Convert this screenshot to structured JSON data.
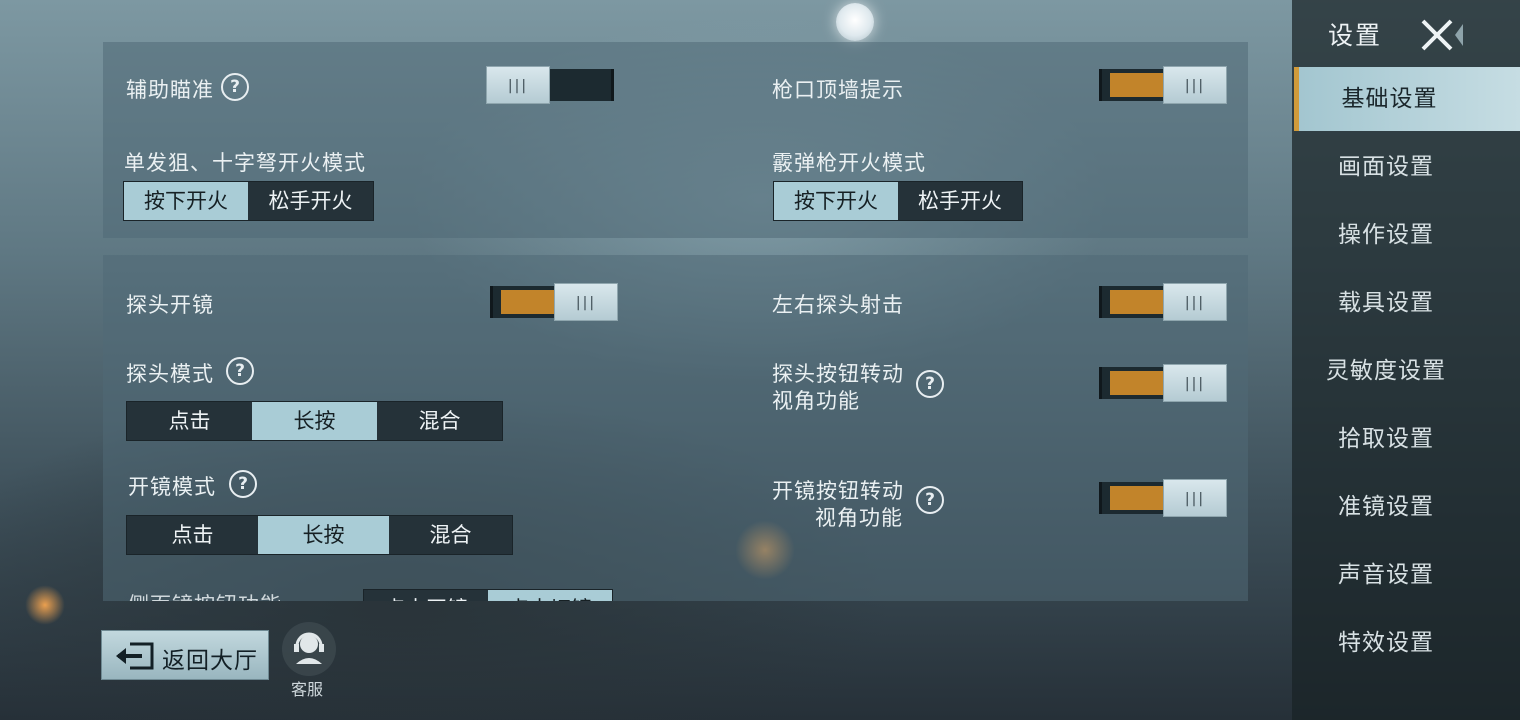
{
  "sidebar": {
    "title": "设置",
    "items": [
      "基础设置",
      "画面设置",
      "操作设置",
      "载具设置",
      "灵敏度设置",
      "拾取设置",
      "准镜设置",
      "声音设置",
      "特效设置"
    ],
    "active": "基础设置"
  },
  "panel1": {
    "assist_aim": {
      "label": "辅助瞄准",
      "on": false
    },
    "muzzle_wall": {
      "label": "枪口顶墙提示",
      "on": true
    },
    "sniper_fire": {
      "label": "单发狙、十字弩开火模式",
      "options": [
        "按下开火",
        "松手开火"
      ],
      "selected": "按下开火"
    },
    "shotgun_fire": {
      "label": "霰弹枪开火模式",
      "options": [
        "按下开火",
        "松手开火"
      ],
      "selected": "按下开火"
    }
  },
  "panel2": {
    "peek_scope": {
      "label": "探头开镜",
      "on": true
    },
    "lr_peek_shoot": {
      "label": "左右探头射击",
      "on": true
    },
    "peek_mode": {
      "label": "探头模式",
      "options": [
        "点击",
        "长按",
        "混合"
      ],
      "selected": "长按"
    },
    "peek_rotate": {
      "label_line1": "探头按钮转动",
      "label_line2": "视角功能",
      "on": true
    },
    "scope_mode": {
      "label": "开镜模式",
      "options": [
        "点击",
        "长按",
        "混合"
      ],
      "selected": "长按"
    },
    "scope_rotate": {
      "label_line1": "开镜按钮转动",
      "label_line2": "视角功能",
      "on": true
    },
    "side_scope_partial": {
      "label": "侧面镜按钮功能",
      "options": [
        "点击开镜",
        "点击切镜"
      ],
      "selected": "点击切镜"
    }
  },
  "footer": {
    "back_label": "返回大厅",
    "cs_label": "客服"
  },
  "colors": {
    "accent_orange": "#c2842a",
    "selected_tab": "#a9ccd6",
    "active_marker": "#d19b3a"
  }
}
